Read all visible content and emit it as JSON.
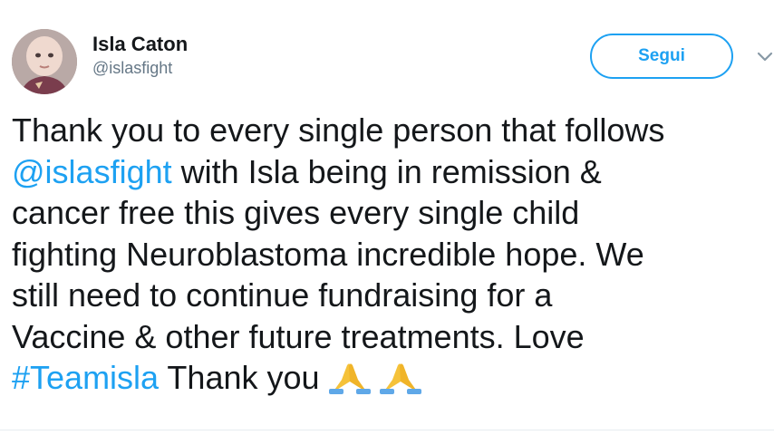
{
  "user": {
    "display_name": "Isla Caton",
    "handle": "@islasfight"
  },
  "actions": {
    "follow_label": "Segui"
  },
  "tweet": {
    "line1": "Thank you to every single person that follows",
    "line2_mention": "@islasfight",
    "line2_rest": " with Isla being in remission &",
    "line3": "cancer free this gives every single child",
    "line4": "fighting Neuroblastoma incredible hope. We",
    "line5": "still need to continue fundraising for a",
    "line6": "Vaccine & other future treatments. Love",
    "line7_hashtag": "#Teamisla",
    "line7_rest": " Thank you"
  },
  "icons": {
    "avatar": "avatar-photo",
    "caret": "chevron-down-icon",
    "emoji": "folded-hands-emoji"
  },
  "colors": {
    "link": "#1da1f2",
    "text": "#14171a",
    "secondary": "#657786"
  }
}
